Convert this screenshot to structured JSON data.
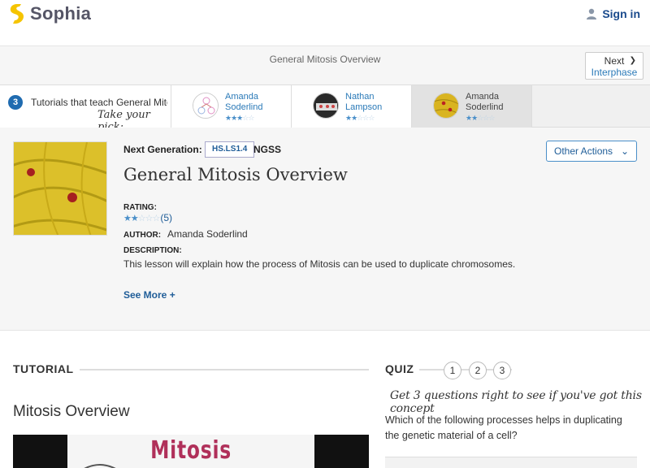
{
  "header": {
    "brand": "Sophia",
    "signin_label": "Sign in"
  },
  "titlebar": {
    "heading": "General Mitosis Overview",
    "next_label": "Next",
    "next_target": "Interphase"
  },
  "tutorials_strip": {
    "count": "3",
    "label": "Tutorials that teach General Mitosis Overview",
    "pick": "Take your pick:",
    "items": [
      {
        "author_first": "Amanda",
        "author_last": "Soderlind",
        "rating": 2.5
      },
      {
        "author_first": "Nathan",
        "author_last": "Lampson",
        "rating": 2
      },
      {
        "author_first": "Amanda",
        "author_last": "Soderlind",
        "rating": 2
      }
    ]
  },
  "lesson": {
    "next_gen_label": "Next Generation:",
    "standard_code": "HS.LS1.4",
    "standard_org": "NGSS",
    "title": "General Mitosis Overview",
    "other_actions": "Other Actions",
    "rating_label": "RATING:",
    "rating_value": 1.5,
    "rating_count": "(5)",
    "author_label": "AUTHOR:",
    "author": "Amanda Soderlind",
    "description_label": "DESCRIPTION:",
    "description": "This lesson will explain how the process of Mitosis can be used to duplicate chromosomes.",
    "see_more": "See More +"
  },
  "tutorial": {
    "section_label": "TUTORIAL",
    "video_title": "Mitosis Overview",
    "video_text": "Mitosis"
  },
  "quiz": {
    "section_label": "QUIZ",
    "numbers": [
      "1",
      "2",
      "3"
    ],
    "prompt": "Get 3 questions right to see if you've got this concept",
    "question": "Which of the following processes helps in duplicating the genetic material of a cell?"
  },
  "colors": {
    "brand_yellow": "#f5c400",
    "link_blue": "#1f5d98",
    "accent_blue": "#4a8fc9"
  }
}
